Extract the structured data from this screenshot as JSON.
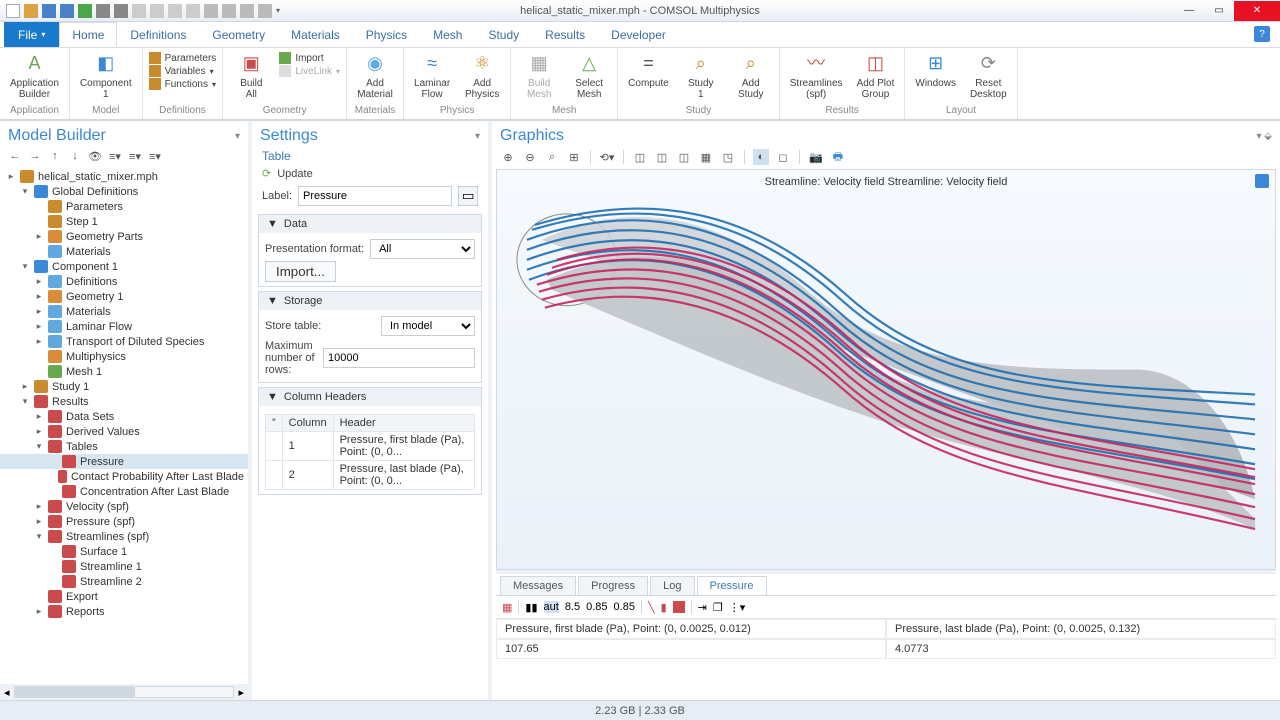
{
  "title": "helical_static_mixer.mph - COMSOL Multiphysics",
  "menu": {
    "file": "File",
    "tabs": [
      "Home",
      "Definitions",
      "Geometry",
      "Materials",
      "Physics",
      "Mesh",
      "Study",
      "Results",
      "Developer"
    ],
    "active": 0
  },
  "ribbon": {
    "application": {
      "label": "Application",
      "builder": "Application\nBuilder"
    },
    "model": {
      "label": "Model",
      "component": "Component\n1"
    },
    "definitions": {
      "label": "Definitions",
      "parameters": "Parameters",
      "variables": "Variables",
      "functions": "Functions"
    },
    "geometry": {
      "label": "Geometry",
      "buildall": "Build\nAll",
      "import": "Import",
      "livelink": "LiveLink"
    },
    "materials": {
      "label": "Materials",
      "add": "Add\nMaterial"
    },
    "physics": {
      "label": "Physics",
      "flow": "Laminar\nFlow",
      "add": "Add\nPhysics"
    },
    "mesh": {
      "label": "Mesh",
      "build": "Build\nMesh",
      "select": "Select\nMesh"
    },
    "study": {
      "label": "Study",
      "compute": "Compute",
      "study1": "Study\n1",
      "add": "Add\nStudy"
    },
    "results": {
      "label": "Results",
      "streamlines": "Streamlines\n(spf)",
      "addplot": "Add Plot\nGroup"
    },
    "layout": {
      "label": "Layout",
      "windows": "Windows",
      "reset": "Reset\nDesktop"
    }
  },
  "modelbuilder": {
    "title": "Model Builder",
    "tree": [
      {
        "d": 0,
        "t": "▸",
        "i": "#c98b2d",
        "l": "helical_static_mixer.mph"
      },
      {
        "d": 1,
        "t": "▾",
        "i": "#3b88d8",
        "l": "Global Definitions"
      },
      {
        "d": 2,
        "t": "",
        "i": "#c98b2d",
        "l": "Parameters"
      },
      {
        "d": 2,
        "t": "",
        "i": "#c98b2d",
        "l": "Step 1"
      },
      {
        "d": 2,
        "t": "▸",
        "i": "#d98c3a",
        "l": "Geometry Parts"
      },
      {
        "d": 2,
        "t": "",
        "i": "#5fa8e0",
        "l": "Materials"
      },
      {
        "d": 1,
        "t": "▾",
        "i": "#3b88d8",
        "l": "Component 1"
      },
      {
        "d": 2,
        "t": "▸",
        "i": "#5fa8e0",
        "l": "Definitions"
      },
      {
        "d": 2,
        "t": "▸",
        "i": "#d98c3a",
        "l": "Geometry 1"
      },
      {
        "d": 2,
        "t": "▸",
        "i": "#5fa8e0",
        "l": "Materials"
      },
      {
        "d": 2,
        "t": "▸",
        "i": "#5fa8e0",
        "l": "Laminar Flow"
      },
      {
        "d": 2,
        "t": "▸",
        "i": "#5fa8e0",
        "l": "Transport of Diluted Species"
      },
      {
        "d": 2,
        "t": "",
        "i": "#d98c3a",
        "l": "Multiphysics"
      },
      {
        "d": 2,
        "t": "",
        "i": "#6aa84f",
        "l": "Mesh 1"
      },
      {
        "d": 1,
        "t": "▸",
        "i": "#c98b2d",
        "l": "Study 1"
      },
      {
        "d": 1,
        "t": "▾",
        "i": "#c94b4b",
        "l": "Results"
      },
      {
        "d": 2,
        "t": "▸",
        "i": "#c94b4b",
        "l": "Data Sets"
      },
      {
        "d": 2,
        "t": "▸",
        "i": "#c94b4b",
        "l": "Derived Values"
      },
      {
        "d": 2,
        "t": "▾",
        "i": "#c94b4b",
        "l": "Tables"
      },
      {
        "d": 3,
        "t": "",
        "i": "#c94b4b",
        "l": "Pressure",
        "sel": true
      },
      {
        "d": 3,
        "t": "",
        "i": "#c94b4b",
        "l": "Contact Probability After Last Blade"
      },
      {
        "d": 3,
        "t": "",
        "i": "#c94b4b",
        "l": "Concentration After Last Blade"
      },
      {
        "d": 2,
        "t": "▸",
        "i": "#c94b4b",
        "l": "Velocity (spf)"
      },
      {
        "d": 2,
        "t": "▸",
        "i": "#c94b4b",
        "l": "Pressure (spf)"
      },
      {
        "d": 2,
        "t": "▾",
        "i": "#c94b4b",
        "l": "Streamlines (spf)"
      },
      {
        "d": 3,
        "t": "",
        "i": "#c94b4b",
        "l": "Surface 1"
      },
      {
        "d": 3,
        "t": "",
        "i": "#c94b4b",
        "l": "Streamline 1"
      },
      {
        "d": 3,
        "t": "",
        "i": "#c94b4b",
        "l": "Streamline 2"
      },
      {
        "d": 2,
        "t": "",
        "i": "#c94b4b",
        "l": "Export"
      },
      {
        "d": 2,
        "t": "▸",
        "i": "#c94b4b",
        "l": "Reports"
      }
    ]
  },
  "settings": {
    "title": "Settings",
    "sub": "Table",
    "update": "Update",
    "label_lbl": "Label:",
    "label_val": "Pressure",
    "data": {
      "head": "Data",
      "pf_lbl": "Presentation format:",
      "pf_val": "All",
      "import": "Import..."
    },
    "storage": {
      "head": "Storage",
      "st_lbl": "Store table:",
      "st_val": "In model",
      "mr_lbl": "Maximum number of rows:",
      "mr_val": "10000"
    },
    "colhead": {
      "head": "Column Headers",
      "col1": "Column",
      "col2": "Header",
      "rows": [
        {
          "c": "1",
          "h": "Pressure, first blade (Pa), Point: (0, 0..."
        },
        {
          "c": "2",
          "h": "Pressure, last blade (Pa), Point: (0, 0..."
        }
      ]
    }
  },
  "graphics": {
    "title": "Graphics",
    "caption": "Streamline: Velocity field  Streamline: Velocity field"
  },
  "bottom": {
    "tabs": [
      "Messages",
      "Progress",
      "Log",
      "Pressure"
    ],
    "active": 3,
    "head1": "Pressure, first blade (Pa), Point: (0, 0.0025, 0.012)",
    "head2": "Pressure, last blade (Pa), Point: (0, 0.0025, 0.132)",
    "v1": "107.65",
    "v2": "4.0773"
  },
  "status": "2.23 GB | 2.33 GB"
}
